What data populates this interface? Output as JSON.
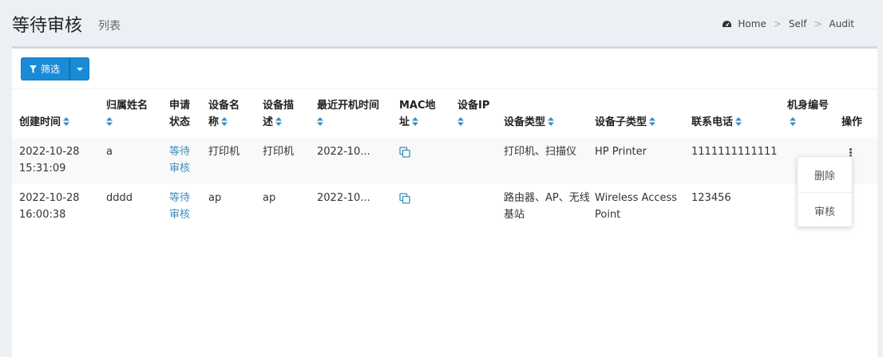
{
  "header": {
    "title": "等待审核",
    "subtitle": "列表"
  },
  "breadcrumb": {
    "items": [
      "Home",
      "Self",
      "Audit"
    ],
    "separator": ">"
  },
  "toolbar": {
    "filter_label": "筛选"
  },
  "table": {
    "columns": [
      {
        "label": "创建时间",
        "sortable": true
      },
      {
        "label": "归属姓名",
        "sortable": true
      },
      {
        "label": "申请状态",
        "sortable": false
      },
      {
        "label": "设备名称",
        "sortable": true
      },
      {
        "label": "设备描述",
        "sortable": true
      },
      {
        "label": "最近开机时间",
        "sortable": true
      },
      {
        "label": "MAC地址",
        "sortable": true
      },
      {
        "label": "设备IP",
        "sortable": true
      },
      {
        "label": "设备类型",
        "sortable": true
      },
      {
        "label": "设备子类型",
        "sortable": true
      },
      {
        "label": "联系电话",
        "sortable": true
      },
      {
        "label": "机身编号",
        "sortable": true
      },
      {
        "label": "操作",
        "sortable": false
      }
    ],
    "rows": [
      {
        "created_date": "2022-10-28",
        "created_time": "15:31:09",
        "owner": "a",
        "status_1": "等待",
        "status_2": "审核",
        "device_name": "打印机",
        "device_desc": "打印机",
        "last_boot": "2022-10...",
        "mac_icon": "copy-icon",
        "ip": "",
        "device_type": "打印机、扫描仪",
        "device_subtype": "HP Printer",
        "phone": "1111111111111",
        "serial": ""
      },
      {
        "created_date": "2022-10-28",
        "created_time": "16:00:38",
        "owner": "dddd",
        "status_1": "等待",
        "status_2": "审核",
        "device_name": "ap",
        "device_desc": "ap",
        "last_boot": "2022-10...",
        "mac_icon": "copy-icon",
        "ip": "",
        "device_type": "路由器、AP、无线基站",
        "device_subtype": "Wireless Access Point",
        "phone": "123456",
        "serial": ""
      }
    ]
  },
  "action_menu": {
    "items": [
      "删除",
      "审核"
    ]
  },
  "colors": {
    "primary": "#1a8bd8",
    "link": "#3c8dbc",
    "background": "#ecf0f5",
    "sort_icon": "#3c8dbc"
  }
}
